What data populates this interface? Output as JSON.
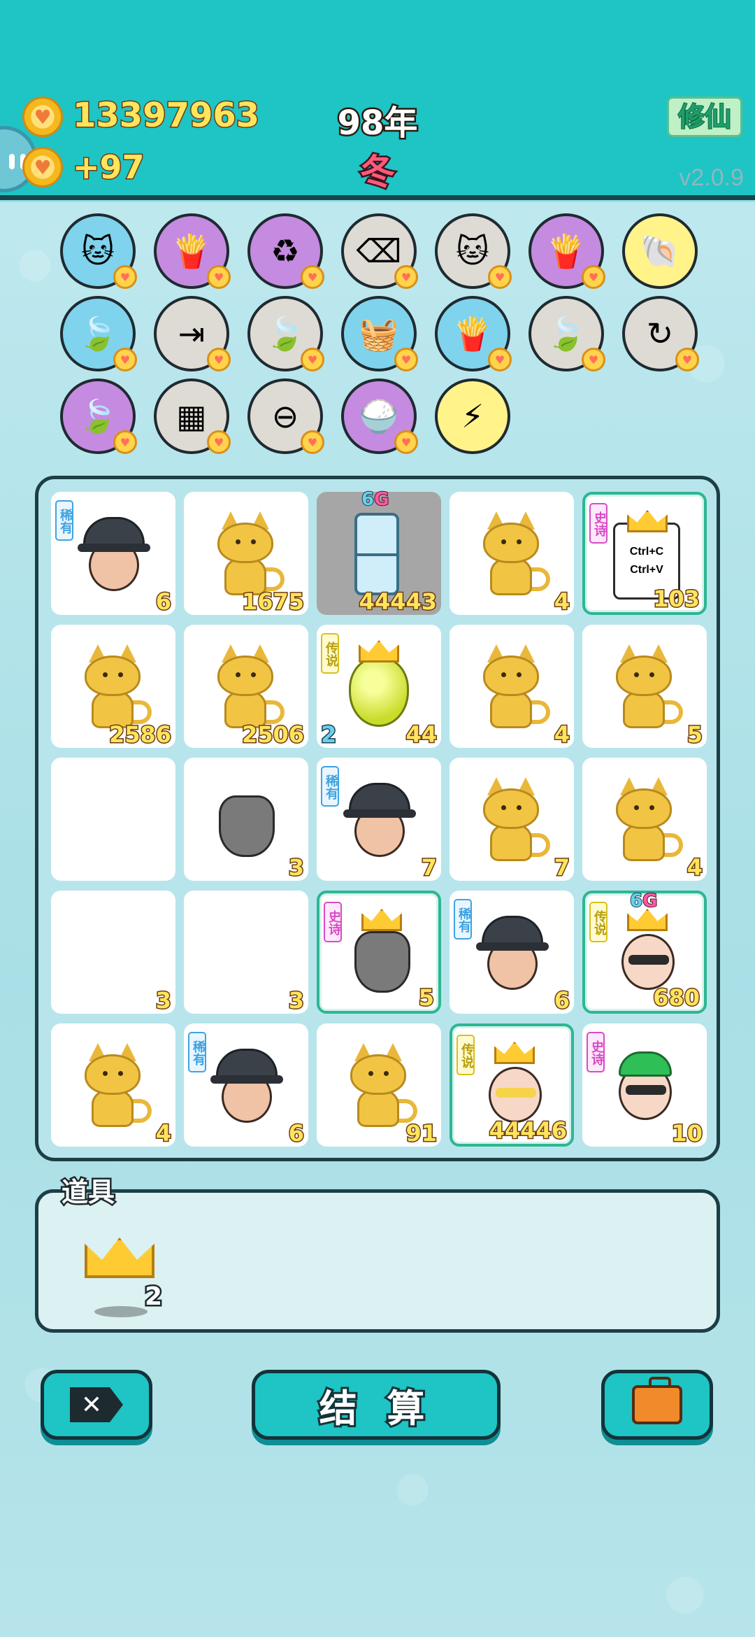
{
  "header": {
    "money": "13397963",
    "income": "+97",
    "year": "98年",
    "season": "冬",
    "xiuxian_label": "修仙",
    "version": "v2.0.9"
  },
  "upgrades": [
    {
      "icon": "cat-upgrade-icon",
      "bg": "blue",
      "glyph": "🐱"
    },
    {
      "icon": "fries-icon",
      "bg": "purple",
      "glyph": "🍟"
    },
    {
      "icon": "recycle-icon",
      "bg": "purple",
      "glyph": "♻"
    },
    {
      "icon": "close-tag-icon",
      "bg": "gray",
      "glyph": "⌫"
    },
    {
      "icon": "cats-pair-icon",
      "bg": "gray",
      "glyph": "🐱"
    },
    {
      "icon": "fries-icon",
      "bg": "purple",
      "glyph": "🍟"
    },
    {
      "icon": "shell-icon",
      "bg": "yellow",
      "glyph": "🐚"
    },
    {
      "icon": "leaf-icon",
      "bg": "blue",
      "glyph": "🍃"
    },
    {
      "icon": "skip-icon",
      "bg": "gray",
      "glyph": "⇥"
    },
    {
      "icon": "leaf-icon",
      "bg": "gray",
      "glyph": "🍃"
    },
    {
      "icon": "fruit-basket-icon",
      "bg": "blue",
      "glyph": "🧺"
    },
    {
      "icon": "fries-icon",
      "bg": "blue",
      "glyph": "🍟"
    },
    {
      "icon": "leaf-icon",
      "bg": "gray",
      "glyph": "🍃"
    },
    {
      "icon": "refresh-icon",
      "bg": "gray",
      "glyph": "↻"
    },
    {
      "icon": "leaf-icon",
      "bg": "purple",
      "glyph": "🍃"
    },
    {
      "icon": "blocks-icon",
      "bg": "gray",
      "glyph": "▦"
    },
    {
      "icon": "minus-icon",
      "bg": "gray",
      "glyph": "⊖"
    },
    {
      "icon": "rice-bowl-icon",
      "bg": "purple",
      "glyph": "🍚"
    },
    {
      "icon": "lightning-icon",
      "bg": "yellow",
      "glyph": "⚡"
    }
  ],
  "board": [
    [
      {
        "item": "hat-man",
        "tag": "稀有",
        "tag_type": "rare",
        "count": "6"
      },
      {
        "item": "cat",
        "count": "1675"
      },
      {
        "item": "fridge",
        "count": "44443",
        "badge": "6G",
        "gray": true
      },
      {
        "item": "cat",
        "count": "4"
      },
      {
        "item": "copy-paste",
        "tag": "史诗",
        "tag_type": "epic",
        "count": "103",
        "framed": true,
        "crown": true,
        "label_top": "Ctrl+C",
        "label_bottom": "Ctrl+V"
      }
    ],
    [
      {
        "item": "cat",
        "count": "2586"
      },
      {
        "item": "cat",
        "count": "2506"
      },
      {
        "item": "pear",
        "tag": "传说",
        "tag_type": "legend",
        "count": "44",
        "count_left": "2",
        "crown": true
      },
      {
        "item": "cat",
        "count": "4"
      },
      {
        "item": "cat",
        "count": "5"
      }
    ],
    [
      {
        "item": "empty",
        "count": ""
      },
      {
        "item": "trash-bag",
        "count": "3"
      },
      {
        "item": "hat-man",
        "tag": "稀有",
        "tag_type": "rare",
        "count": "7"
      },
      {
        "item": "cat",
        "count": "7"
      },
      {
        "item": "cat",
        "count": "4"
      }
    ],
    [
      {
        "item": "empty",
        "count": "3"
      },
      {
        "item": "empty",
        "count": "3"
      },
      {
        "item": "trash-copy",
        "tag": "史诗",
        "tag_type": "epic",
        "count": "5",
        "framed": true,
        "crown": true
      },
      {
        "item": "hat-man",
        "tag": "稀有",
        "tag_type": "rare",
        "count": "6"
      },
      {
        "item": "sunglasses-man",
        "tag": "传说",
        "tag_type": "legend",
        "count": "680",
        "framed": true,
        "crown": true,
        "badge": "6G"
      }
    ],
    [
      {
        "item": "cat",
        "count": "4"
      },
      {
        "item": "hat-man",
        "tag": "稀有",
        "tag_type": "rare",
        "count": "6"
      },
      {
        "item": "cat",
        "count": "91"
      },
      {
        "item": "old-man",
        "tag": "传说",
        "tag_type": "legend",
        "count": "44446",
        "framed": true,
        "crown": true
      },
      {
        "item": "green-hat-man",
        "tag": "史诗",
        "tag_type": "epic",
        "count": "10"
      }
    ]
  ],
  "props": {
    "label": "道具",
    "items": [
      {
        "icon": "crown-icon",
        "count": "2"
      }
    ]
  },
  "buttons": {
    "settle_label": "结 算"
  },
  "colors": {
    "header_bg": "#1fc4c4",
    "accent_gold": "#ffe45c",
    "season_red": "#ff5a78",
    "rare": "#3ea3e0",
    "epic": "#d84bc5",
    "legend": "#d8c01a"
  }
}
